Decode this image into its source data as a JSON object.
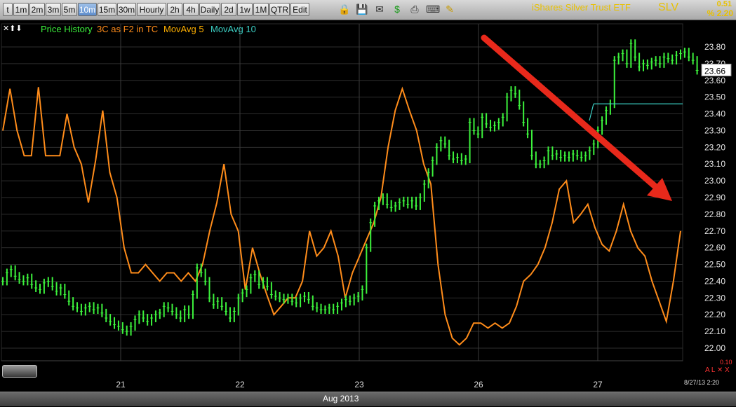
{
  "toolbar": {
    "timeframes": [
      "t",
      "1m",
      "2m",
      "3m",
      "5m",
      "10m",
      "15m",
      "30m",
      "Hourly",
      "2h",
      "4h",
      "Daily",
      "2d",
      "1w",
      "1M",
      "QTR",
      "Edit"
    ],
    "active": "10m",
    "icons": [
      "lock-icon",
      "save-icon",
      "mail-icon",
      "dollar-icon",
      "print-icon",
      "keyboard-icon",
      "pencil-icon"
    ]
  },
  "header": {
    "title": "iShares Silver Trust ETF",
    "ticker": "SLV",
    "change": "0.51",
    "change_pct": "% 2.20"
  },
  "legend": {
    "arrows": "✕⬆⬇",
    "price_history": "Price History",
    "indicator": "3C as F2 in TC",
    "mavg5": "MovAvg 5",
    "mavg10": "MovAvg 10"
  },
  "colors": {
    "price": "#3cf23c",
    "indicator": "#ff8c1a",
    "mavg5": "#ffb000",
    "mavg10": "#3ccfc4",
    "arrow": "#e8291b",
    "text_yellow": "#e8c000"
  },
  "chart_data": {
    "type": "line",
    "y_ticks": [
      22.0,
      22.1,
      22.2,
      22.3,
      22.4,
      22.5,
      22.6,
      22.7,
      22.8,
      22.9,
      23.0,
      23.1,
      23.2,
      23.3,
      23.4,
      23.5,
      23.6,
      23.7,
      23.8
    ],
    "ylim": [
      21.96,
      23.88
    ],
    "last_price": "23.66",
    "x_days": [
      "21",
      "22",
      "23",
      "26",
      "27"
    ],
    "x_label": "Aug 2013",
    "date_stamp": "8/27/13 2:20",
    "lower_pane_value": "0.10",
    "lower_pane_flags": "A L ✕ X",
    "n_bars": 165,
    "series": [
      {
        "name": "Price History",
        "values": [
          22.4,
          22.45,
          22.47,
          22.43,
          22.41,
          22.4,
          22.42,
          22.38,
          22.36,
          22.35,
          22.39,
          22.4,
          22.37,
          22.34,
          22.36,
          22.32,
          22.28,
          22.25,
          22.24,
          22.22,
          22.24,
          22.25,
          22.23,
          22.24,
          22.21,
          22.18,
          22.16,
          22.14,
          22.13,
          22.11,
          22.1,
          22.13,
          22.17,
          22.2,
          22.18,
          22.16,
          22.18,
          22.2,
          22.21,
          22.25,
          22.24,
          22.22,
          22.2,
          22.18,
          22.23,
          22.2,
          22.32,
          22.48,
          22.45,
          22.4,
          22.3,
          22.26,
          22.28,
          22.25,
          22.22,
          22.18,
          22.22,
          22.3,
          22.33,
          22.35,
          22.42,
          22.44,
          22.38,
          22.4,
          22.37,
          22.32,
          22.31,
          22.3,
          22.29,
          22.3,
          22.28,
          22.27,
          22.3,
          22.31,
          22.29,
          22.25,
          22.24,
          22.23,
          22.23,
          22.24,
          22.23,
          22.25,
          22.27,
          22.29,
          22.28,
          22.3,
          22.31,
          22.35,
          22.6,
          22.75,
          22.85,
          22.88,
          22.9,
          22.86,
          22.84,
          22.85,
          22.87,
          22.88,
          22.86,
          22.88,
          22.85,
          22.9,
          22.98,
          23.05,
          23.12,
          23.2,
          23.24,
          23.22,
          23.15,
          23.13,
          23.14,
          23.12,
          23.13,
          23.35,
          23.3,
          23.28,
          23.38,
          23.34,
          23.32,
          23.33,
          23.35,
          23.38,
          23.5,
          23.54,
          23.52,
          23.45,
          23.35,
          23.28,
          23.15,
          23.1,
          23.1,
          23.12,
          23.18,
          23.15,
          23.16,
          23.14,
          23.15,
          23.14,
          23.16,
          23.15,
          23.14,
          23.15,
          23.18,
          23.22,
          23.3,
          23.36,
          23.42,
          23.46,
          23.72,
          23.74,
          23.76,
          23.7,
          23.82,
          23.74,
          23.68,
          23.7,
          23.69,
          23.71,
          23.72,
          23.7,
          23.74,
          23.73,
          23.72,
          23.75,
          23.76,
          23.77,
          23.74,
          23.72,
          23.66
        ]
      },
      {
        "name": "3C as F2 in TC",
        "values": [
          23.3,
          23.55,
          23.3,
          23.15,
          23.15,
          23.56,
          23.15,
          23.15,
          23.15,
          23.4,
          23.2,
          23.1,
          22.87,
          23.12,
          23.42,
          23.05,
          22.9,
          22.6,
          22.45,
          22.45,
          22.5,
          22.45,
          22.4,
          22.45,
          22.45,
          22.4,
          22.45,
          22.4,
          22.5,
          22.7,
          22.87,
          23.1,
          22.8,
          22.7,
          22.35,
          22.6,
          22.45,
          22.32,
          22.2,
          22.25,
          22.3,
          22.3,
          22.4,
          22.7,
          22.55,
          22.6,
          22.7,
          22.55,
          22.3,
          22.45,
          22.55,
          22.65,
          22.75,
          22.9,
          23.2,
          23.42,
          23.55,
          23.42,
          23.3,
          23.1,
          22.98,
          22.5,
          22.2,
          22.06,
          22.02,
          22.06,
          22.15,
          22.15,
          22.12,
          22.15,
          22.12,
          22.15,
          22.25,
          22.4,
          22.44,
          22.5,
          22.6,
          22.75,
          22.95,
          23.0,
          22.75,
          22.8,
          22.86,
          22.72,
          22.62,
          22.58,
          22.7,
          22.86,
          22.7,
          22.6,
          22.55,
          22.4,
          22.28,
          22.16,
          22.4,
          22.7
        ]
      },
      {
        "name": "MovAvg 10",
        "values": [
          23.46
        ]
      }
    ]
  }
}
